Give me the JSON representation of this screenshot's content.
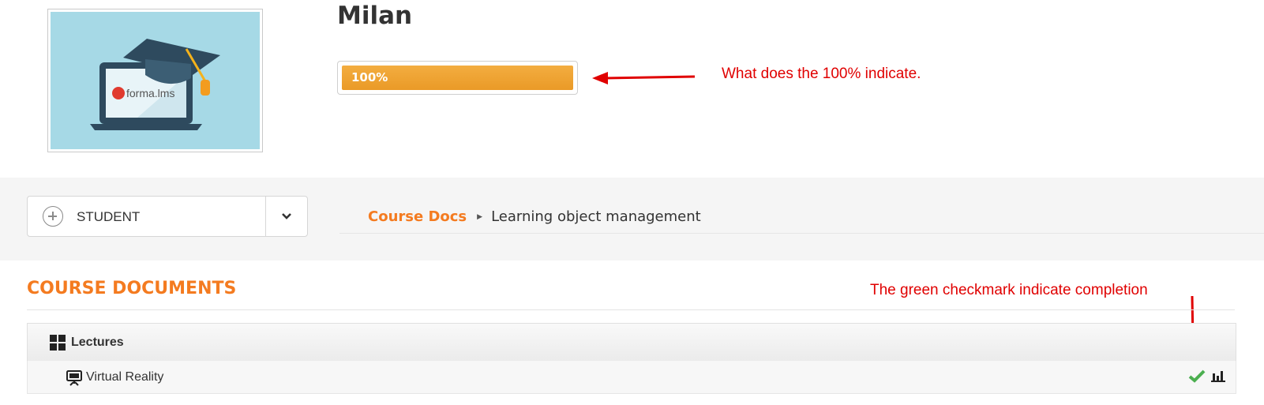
{
  "course": {
    "title": "Milan",
    "logo_text": "forma.lms",
    "progress_percent": 100,
    "progress_label": "100%"
  },
  "annotations": {
    "progress_note": "What does the 100% indicate.",
    "checkmark_note": "The green checkmark indicate completion",
    "color": "#e00000"
  },
  "role_selector": {
    "value": "STUDENT"
  },
  "breadcrumb": {
    "link": "Course Docs",
    "current": "Learning object management"
  },
  "section": {
    "title": "COURSE DOCUMENTS"
  },
  "folder": {
    "label": "Lectures"
  },
  "items": [
    {
      "label": "Virtual Reality",
      "status": "completed"
    }
  ],
  "colors": {
    "accent": "#f47b20",
    "progress": "#ee9f2d",
    "complete": "#4caf50",
    "logo_bg": "#a6d9e6"
  }
}
